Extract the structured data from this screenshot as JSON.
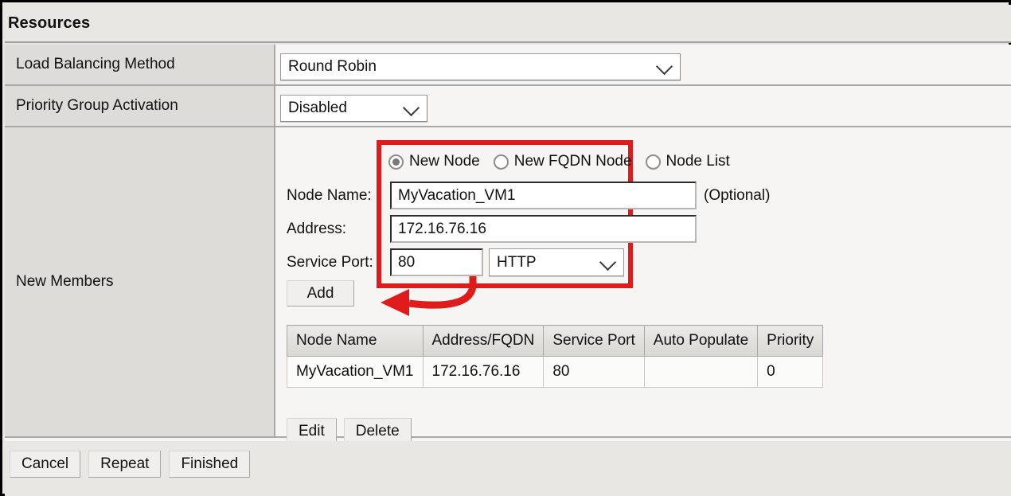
{
  "header": {
    "title": "Resources"
  },
  "rows": {
    "load_balancing": {
      "label": "Load Balancing Method",
      "value": "Round Robin"
    },
    "priority_group": {
      "label": "Priority Group Activation",
      "value": "Disabled"
    },
    "new_members": {
      "label": "New Members"
    }
  },
  "member_form": {
    "radios": [
      {
        "label": "New Node",
        "selected": true
      },
      {
        "label": "New FQDN Node",
        "selected": false
      },
      {
        "label": "Node List",
        "selected": false
      }
    ],
    "node_name_label": "Node Name:",
    "node_name_value": "MyVacation_VM1",
    "node_name_optional": "(Optional)",
    "address_label": "Address:",
    "address_value": "172.16.76.16",
    "service_port_label": "Service Port:",
    "service_port_value": "80",
    "service_port_protocol": "HTTP",
    "add_button": "Add"
  },
  "members_table": {
    "columns": [
      "Node Name",
      "Address/FQDN",
      "Service Port",
      "Auto Populate",
      "Priority"
    ],
    "rows": [
      {
        "node_name": "MyVacation_VM1",
        "address": "172.16.76.16",
        "service_port": "80",
        "auto_populate": "",
        "priority": "0"
      }
    ],
    "edit_button": "Edit",
    "delete_button": "Delete"
  },
  "footer": {
    "cancel": "Cancel",
    "repeat": "Repeat",
    "finished": "Finished"
  },
  "annotations": {
    "highlight_color": "#e01b1b"
  }
}
